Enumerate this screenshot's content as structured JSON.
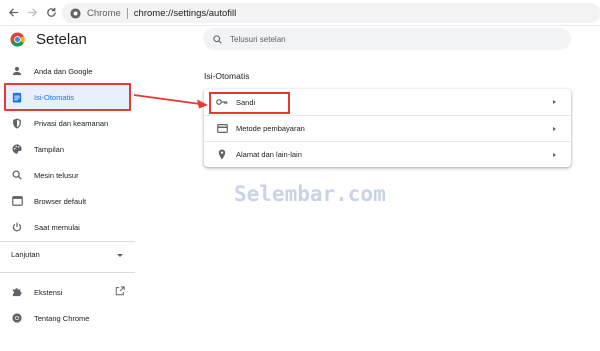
{
  "browser": {
    "site_label": "Chrome",
    "url": "chrome://settings/autofill",
    "icons": [
      "back-arrow-icon",
      "forward-arrow-icon",
      "reload-icon",
      "chrome-site-icon"
    ]
  },
  "header": {
    "title": "Setelan",
    "search_placeholder": "Telusuri setelan"
  },
  "sidebar": {
    "items": [
      {
        "label": "Anda dan Google",
        "icon": "person-icon",
        "active": false
      },
      {
        "label": "Isi-Otomatis",
        "icon": "assignment-icon",
        "active": true
      },
      {
        "label": "Privasi dan keamanan",
        "icon": "shield-icon",
        "active": false
      },
      {
        "label": "Tampilan",
        "icon": "palette-icon",
        "active": false
      },
      {
        "label": "Mesin telusur",
        "icon": "search-icon",
        "active": false
      },
      {
        "label": "Browser default",
        "icon": "browser-icon",
        "active": false
      },
      {
        "label": "Saat memulai",
        "icon": "power-icon",
        "active": false
      }
    ],
    "advanced_label": "Lanjutan",
    "extensions_label": "Ekstensi",
    "about_label": "Tentang Chrome"
  },
  "main": {
    "section_title": "Isi-Otomatis",
    "rows": [
      {
        "label": "Sandi",
        "icon": "key-icon"
      },
      {
        "label": "Metode pembayaran",
        "icon": "credit-card-icon"
      },
      {
        "label": "Alamat dan lain-lain",
        "icon": "location-pin-icon"
      }
    ]
  },
  "annotation": {
    "highlight_color": "#e53935",
    "watermark": "Selembar.com"
  },
  "colors": {
    "accent": "#1a73e8",
    "active_bg": "#e8f0fe",
    "search_bg": "#f1f3f4",
    "icon_gray": "#5f6368"
  }
}
